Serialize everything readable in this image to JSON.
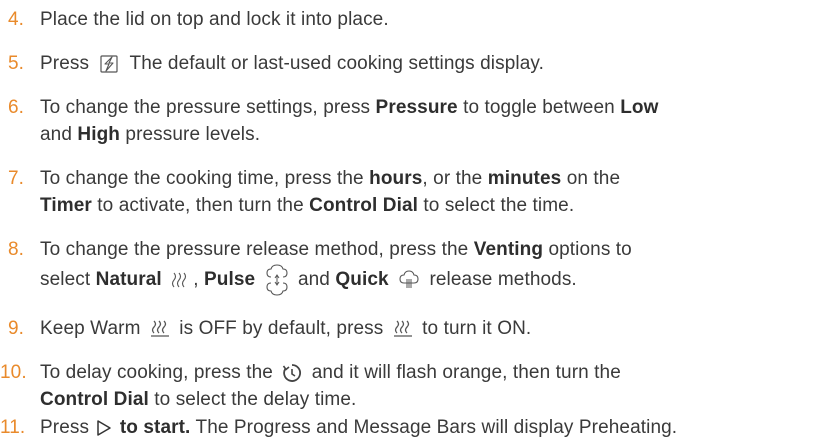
{
  "colors": {
    "number": "#e98a2b",
    "text": "#3a3a3a"
  },
  "steps": [
    {
      "num": "4.",
      "l1": "Place the lid on top and lock it into place."
    },
    {
      "num": "5.",
      "a": "Press",
      "icon": "start-cooking-icon",
      "b": "The default or last-used cooking settings display."
    },
    {
      "num": "6.",
      "a": "To change the pressure settings, press",
      "pressure": "Pressure",
      "b": "to toggle between",
      "low": "Low",
      "c": "and",
      "high": "High",
      "d": "pressure levels."
    },
    {
      "num": "7.",
      "a": "To change the cooking time, press the",
      "hours": "hours",
      "b": ", or the",
      "minutes": "minutes",
      "c": "on the",
      "timer": "Timer",
      "d": "to activate, then turn the",
      "dial": "Control Dial",
      "e": "to select the time."
    },
    {
      "num": "8.",
      "a": "To change the pressure release method, press the",
      "venting": "Venting",
      "b": "options to",
      "c": "select",
      "natural": "Natural",
      "pulse": "Pulse",
      "and": "and",
      "quick": "Quick",
      "d": "release methods."
    },
    {
      "num": "9.",
      "a": "Keep Warm",
      "b": "is OFF by default, press",
      "c": "to turn it ON."
    },
    {
      "num": "10.",
      "a": "To delay cooking, press the",
      "b": "and it will flash orange, then turn the",
      "dial": "Control Dial",
      "c": "to select the delay time."
    },
    {
      "num": "11.",
      "a": "Press",
      "start": "to start.",
      "b": "The Progress and Message Bars will display Preheating."
    }
  ]
}
